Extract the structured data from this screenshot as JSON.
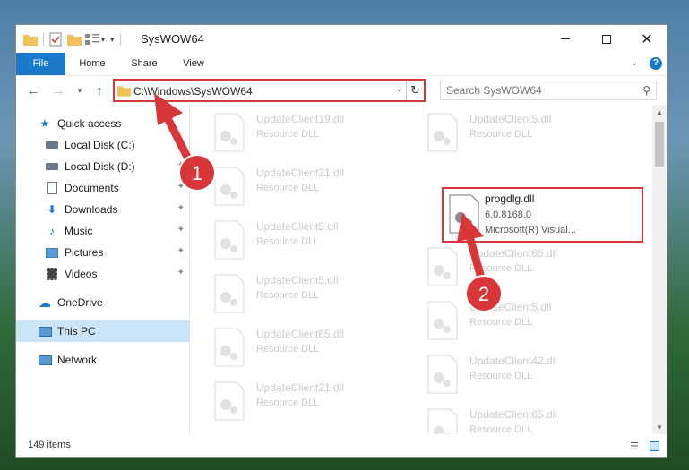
{
  "window": {
    "title": "SysWOW64"
  },
  "ribbon": {
    "tabs": [
      "File",
      "Home",
      "Share",
      "View"
    ]
  },
  "address": {
    "path": "C:\\Windows\\SysWOW64",
    "search_placeholder": "Search SysWOW64"
  },
  "sidebar": {
    "items": [
      {
        "label": "Quick access"
      },
      {
        "label": "Local Disk (C:)"
      },
      {
        "label": "Local Disk (D:)"
      },
      {
        "label": "Documents"
      },
      {
        "label": "Downloads"
      },
      {
        "label": "Music"
      },
      {
        "label": "Pictures"
      },
      {
        "label": "Videos"
      },
      {
        "label": "OneDrive"
      },
      {
        "label": "This PC"
      },
      {
        "label": "Network"
      }
    ]
  },
  "files": {
    "left": [
      {
        "name": "UpdateClient19.dll",
        "type": "Resource DLL"
      },
      {
        "name": "UpdateClient21.dll",
        "type": "Resource DLL"
      },
      {
        "name": "UpdateClient5.dll",
        "type": "Resource DLL"
      },
      {
        "name": "UpdateClient5.dll",
        "type": "Resource DLL"
      },
      {
        "name": "UpdateClient65.dll",
        "type": "Resource DLL"
      },
      {
        "name": "UpdateClient21.dll",
        "type": "Resource DLL"
      }
    ],
    "right": [
      {
        "name": "UpdateClient5.dll",
        "type": "Resource DLL"
      },
      {
        "name": "UpdateClient65.dll",
        "type": "Resource DLL"
      },
      {
        "name": "UpdateClient5.dll",
        "type": "Resource DLL"
      },
      {
        "name": "UpdateClient42.dll",
        "type": "Resource DLL"
      },
      {
        "name": "UpdateClient65.dll",
        "type": "Resource DLL"
      }
    ],
    "highlighted": {
      "name": "progdlg.dll",
      "version": "6.0.8168.0",
      "description": "Microsoft(R) Visual..."
    }
  },
  "status": {
    "count": "149 items"
  },
  "annotations": {
    "step1": "1",
    "step2": "2"
  },
  "colors": {
    "accent": "#1979ca",
    "highlight_border": "#d9363a",
    "selected_bg": "#cce4f7"
  }
}
